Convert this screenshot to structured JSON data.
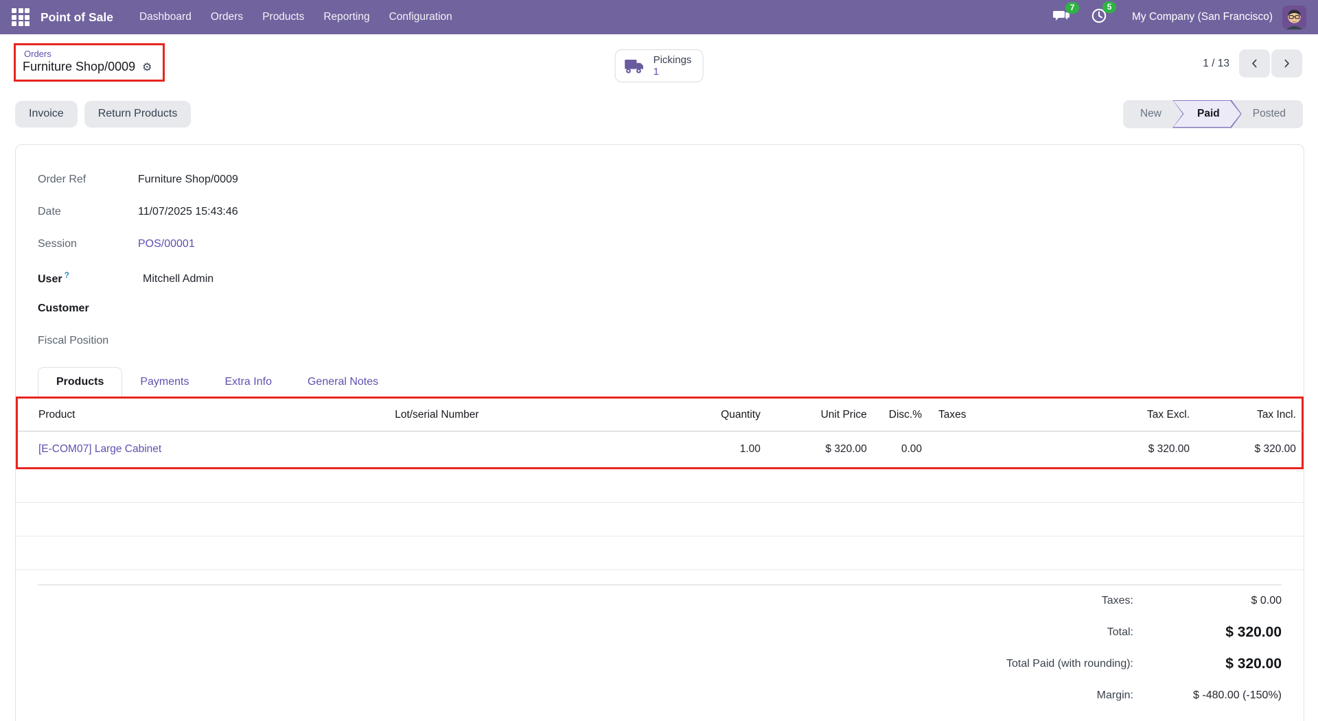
{
  "app": {
    "name": "Point of Sale"
  },
  "nav": {
    "menu": [
      "Dashboard",
      "Orders",
      "Products",
      "Reporting",
      "Configuration"
    ],
    "messages_badge": "7",
    "activities_badge": "5",
    "company": "My Company (San Francisco)"
  },
  "breadcrumb": {
    "parent": "Orders",
    "current": "Furniture Shop/0009"
  },
  "smart_button": {
    "label": "Pickings",
    "count": "1"
  },
  "pager": {
    "position": "1 / 13"
  },
  "actions": {
    "invoice": "Invoice",
    "return_products": "Return Products"
  },
  "statusbar": {
    "new": "New",
    "paid": "Paid",
    "posted": "Posted",
    "active": "Paid"
  },
  "fields": {
    "order_ref": {
      "label": "Order Ref",
      "value": "Furniture Shop/0009"
    },
    "date": {
      "label": "Date",
      "value": "11/07/2025 15:43:46"
    },
    "session": {
      "label": "Session",
      "value": "POS/00001"
    },
    "user": {
      "label": "User",
      "help": "?",
      "value": "Mitchell Admin"
    },
    "customer": {
      "label": "Customer",
      "value": ""
    },
    "fiscal_position": {
      "label": "Fiscal Position",
      "value": ""
    }
  },
  "tabs": {
    "products": "Products",
    "payments": "Payments",
    "extra_info": "Extra Info",
    "general_notes": "General Notes"
  },
  "products_table": {
    "headers": {
      "product": "Product",
      "lot": "Lot/serial Number",
      "quantity": "Quantity",
      "unit_price": "Unit Price",
      "discount": "Disc.%",
      "taxes": "Taxes",
      "tax_excl": "Tax Excl.",
      "tax_incl": "Tax Incl."
    },
    "row": {
      "product": "[E-COM07] Large Cabinet",
      "lot": "",
      "quantity": "1.00",
      "unit_price": "$ 320.00",
      "discount": "0.00",
      "taxes": "",
      "tax_excl": "$ 320.00",
      "tax_incl": "$ 320.00"
    }
  },
  "totals": {
    "taxes": {
      "label": "Taxes:",
      "value": "$ 0.00"
    },
    "total": {
      "label": "Total:",
      "value": "$ 320.00"
    },
    "total_paid": {
      "label": "Total Paid (with rounding):",
      "value": "$ 320.00"
    },
    "margin": {
      "label": "Margin:",
      "value": "$ -480.00 (-150%)"
    }
  },
  "icons": {
    "settings_gear": "⚙"
  },
  "colors": {
    "navbar": "#71639e",
    "link": "#5f50b0",
    "badge_green": "#2fb344",
    "annotation_red": "#e8251f",
    "button_gray": "#e7e9ed",
    "status_active_fill": "#eceaf7",
    "status_active_border": "#8b7cc0"
  }
}
